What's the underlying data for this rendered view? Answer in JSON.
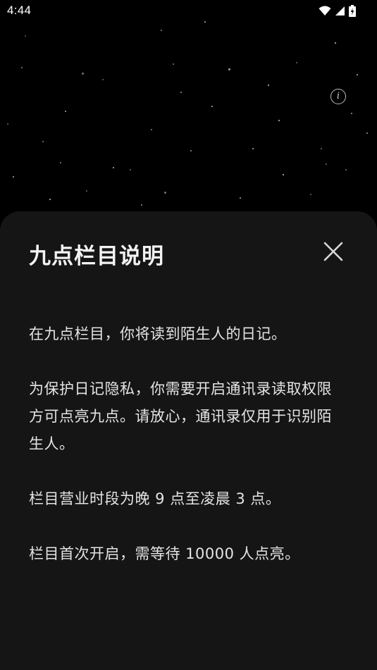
{
  "status_bar": {
    "time": "4:44",
    "icons": [
      "wifi-icon",
      "cellular-signal-icon",
      "battery-charging-icon"
    ]
  },
  "header": {
    "info_icon_glyph": "i"
  },
  "sheet": {
    "title": "九点栏目说明",
    "close_icon": "close-icon",
    "paragraphs": [
      "在九点栏目，你将读到陌生人的日记。",
      "为保护日记隐私，你需要开启通讯录读取权限方可点亮九点。请放心，通讯录仅用于识别陌生人。",
      "栏目营业时段为晚 9 点至凌晨 3 点。",
      "栏目首次开启，需等待 10000 人点亮。"
    ]
  },
  "colors": {
    "background": "#000000",
    "sheet_background": "#151516",
    "text": "#e4e4e4",
    "title": "#f2f2f2"
  }
}
